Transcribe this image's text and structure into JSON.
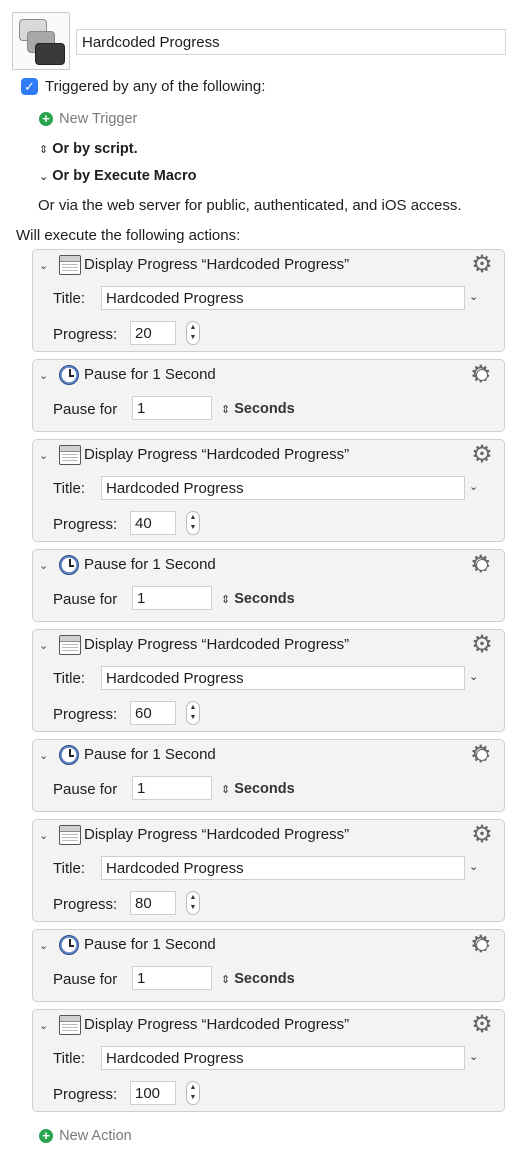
{
  "macro": {
    "name": "Hardcoded Progress"
  },
  "triggers": {
    "checkbox_label": "Triggered by any of the following:",
    "new_trigger": "New Trigger",
    "or_by_script": "Or by script.",
    "or_by_execute_macro": "Or by Execute Macro",
    "web_server_note": "Or via the web server for public, authenticated, and iOS access."
  },
  "actions_header": "Will execute the following actions:",
  "labels": {
    "title": "Title:",
    "progress": "Progress:",
    "pause_for": "Pause for",
    "seconds": "Seconds"
  },
  "actions": [
    {
      "type": "progress",
      "heading": "Display Progress “Hardcoded Progress”",
      "title_value": "Hardcoded Progress",
      "progress_value": "20"
    },
    {
      "type": "pause",
      "heading": "Pause for 1 Second",
      "pause_value": "1"
    },
    {
      "type": "progress",
      "heading": "Display Progress “Hardcoded Progress”",
      "title_value": "Hardcoded Progress",
      "progress_value": "40"
    },
    {
      "type": "pause",
      "heading": "Pause for 1 Second",
      "pause_value": "1"
    },
    {
      "type": "progress",
      "heading": "Display Progress “Hardcoded Progress”",
      "title_value": "Hardcoded Progress",
      "progress_value": "60"
    },
    {
      "type": "pause",
      "heading": "Pause for 1 Second",
      "pause_value": "1"
    },
    {
      "type": "progress",
      "heading": "Display Progress “Hardcoded Progress”",
      "title_value": "Hardcoded Progress",
      "progress_value": "80"
    },
    {
      "type": "pause",
      "heading": "Pause for 1 Second",
      "pause_value": "1"
    },
    {
      "type": "progress",
      "heading": "Display Progress “Hardcoded Progress”",
      "title_value": "Hardcoded Progress",
      "progress_value": "100"
    }
  ],
  "new_action": "New Action",
  "colors": {
    "checkbox": "#2f7cf6",
    "add_green": "#2aa44f",
    "card_bg": "#f3f3f3"
  }
}
